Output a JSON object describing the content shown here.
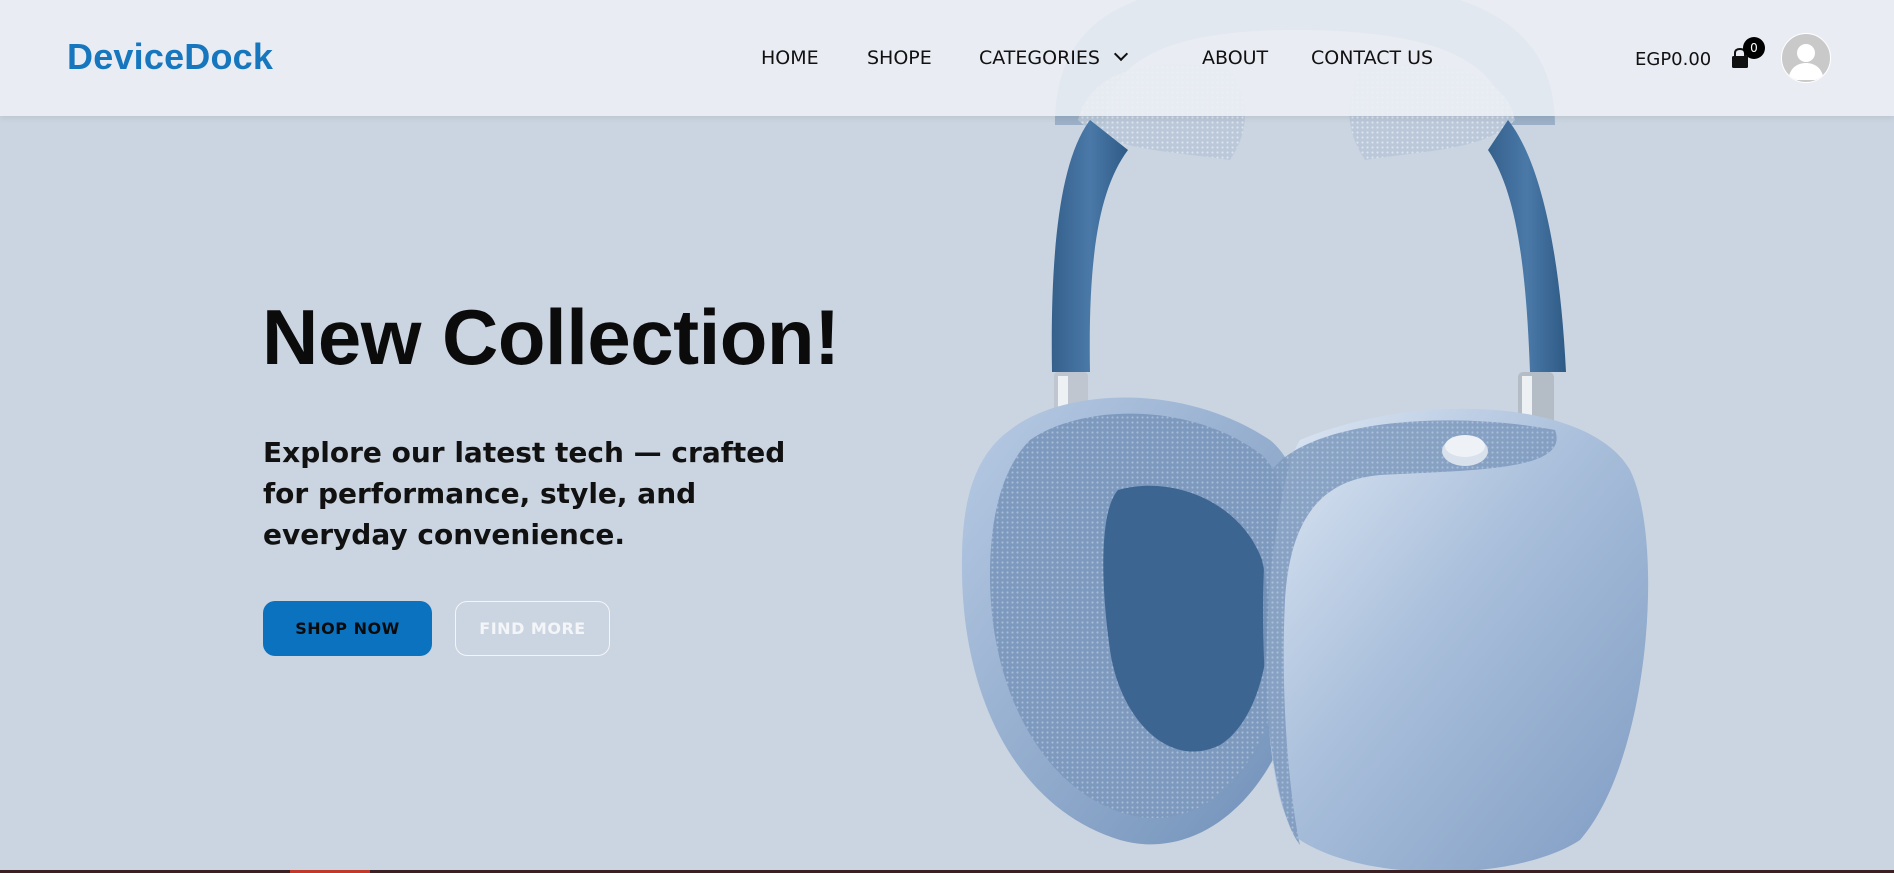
{
  "brand": {
    "name": "DeviceDock"
  },
  "nav": {
    "items": [
      {
        "label": "HOME"
      },
      {
        "label": "SHOPE"
      },
      {
        "label": "CATEGORIES"
      },
      {
        "label": "ABOUT"
      },
      {
        "label": "CONTACT US"
      }
    ]
  },
  "cart": {
    "total": "EGP0.00",
    "count": "0",
    "icon": "shopping-bag-icon"
  },
  "user": {
    "icon": "user-avatar-icon"
  },
  "hero": {
    "title": "New Collection!",
    "subtitle": "Explore our latest tech — crafted for performance, style, and everyday convenience.",
    "primary_button": "SHOP NOW",
    "secondary_button": "FIND MORE",
    "image": "headphones-image"
  },
  "colors": {
    "brand": "#1677be",
    "hero_background": "#cbd5e1",
    "primary_button": "#0b72c0",
    "navbar": "#eef1f6"
  }
}
